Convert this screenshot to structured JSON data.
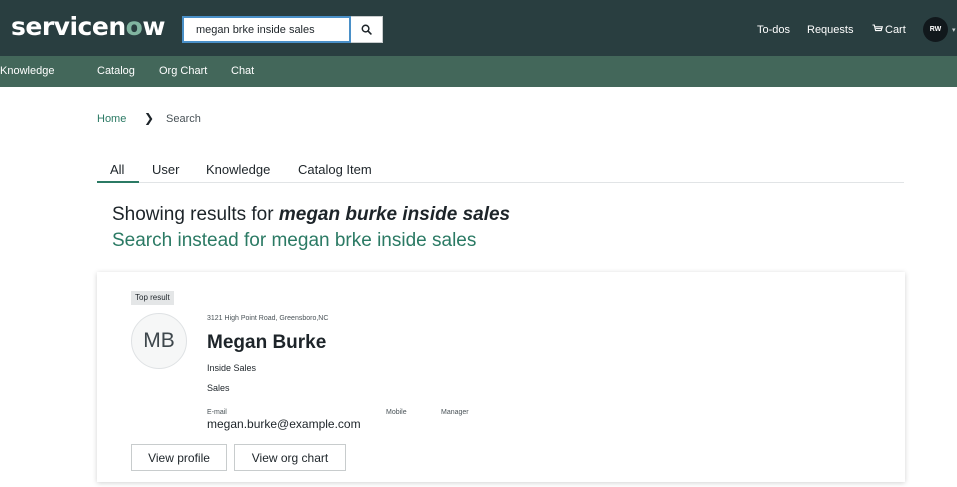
{
  "header": {
    "logo_pre": "servic",
    "logo_o": "e",
    "logo_mid": "n",
    "logo_o2": "o",
    "logo_post": "w",
    "search_value": "megan brke inside sales",
    "search_icon": "search-icon",
    "links": {
      "todos": "To-dos",
      "requests": "Requests",
      "cart": "Cart"
    },
    "cart_icon": "cart-icon",
    "avatar_initials": "RW",
    "colors": {
      "header_bg": "#293e40",
      "nav_bg": "#43675a",
      "accent": "#2b7a64"
    }
  },
  "nav": {
    "items": [
      "Knowledge",
      "Catalog",
      "Org Chart",
      "Chat"
    ]
  },
  "breadcrumb": {
    "home": "Home",
    "separator_icon": "chevron-right-icon",
    "current": "Search"
  },
  "tabs": {
    "items": [
      "All",
      "User",
      "Knowledge",
      "Catalog Item"
    ],
    "active": "All"
  },
  "results": {
    "showing_prefix": "Showing results for ",
    "query": "megan burke inside sales",
    "instead": "Search instead for megan brke inside sales"
  },
  "card": {
    "badge": "Top result",
    "initials": "MB",
    "address": "3121 High Point Road, Greensboro,NC",
    "name": "Megan Burke",
    "title": "Inside Sales",
    "department": "Sales",
    "email_label": "E-mail",
    "email": "megan.burke@example.com",
    "mobile_label": "Mobile",
    "manager_label": "Manager",
    "view_profile": "View profile",
    "view_org_chart": "View org chart"
  }
}
